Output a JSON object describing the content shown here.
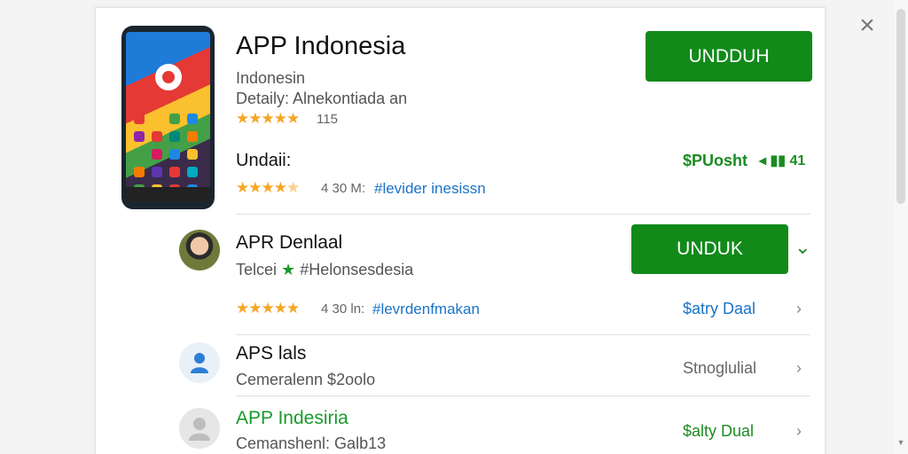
{
  "close_symbol": "×",
  "icons": {
    "close": "close-icon",
    "chevron": "chevron-right-icon",
    "expand": "chevron-down-icon",
    "star": "star-icon"
  },
  "colors": {
    "accent_green": "#118a1a",
    "link_blue": "#1a73c8",
    "star_gold": "#f5a623"
  },
  "header": {
    "title": "APP Indonesia",
    "subtitle": "Indonesin",
    "detail": "Detaily: Alnekontiada an",
    "rating_value": 4.5,
    "rating_count": "115",
    "download_label": "UNDDUH"
  },
  "section": {
    "title": "Undaii:",
    "rating_value": 4.0,
    "rating_text": "4 30 M:",
    "link": "#levider inesissn",
    "right_label": "$PUosht",
    "right_extra": "◂ ▮▮ 41"
  },
  "rows": [
    {
      "title": "APR Denlaal",
      "subtitle_prefix": "Telcei",
      "subtitle_suffix": "#Helonsesdesia",
      "rating_value": 5.0,
      "rating_text": "4 30 ln:",
      "link": "#levrdenfmakan",
      "download_label": "UNDUK",
      "right_label": "$atry Daal",
      "chevron": "›",
      "expand": "⌄"
    },
    {
      "title": "APS lals",
      "subtitle": "Cemeralenn $2oolo",
      "right_label": "Stnoglulial",
      "chevron": "›"
    },
    {
      "title": "APP Indesiria",
      "subtitle": "Cemanshenl: Galb13",
      "right_label": "$alty Dual",
      "chevron": "›"
    }
  ]
}
